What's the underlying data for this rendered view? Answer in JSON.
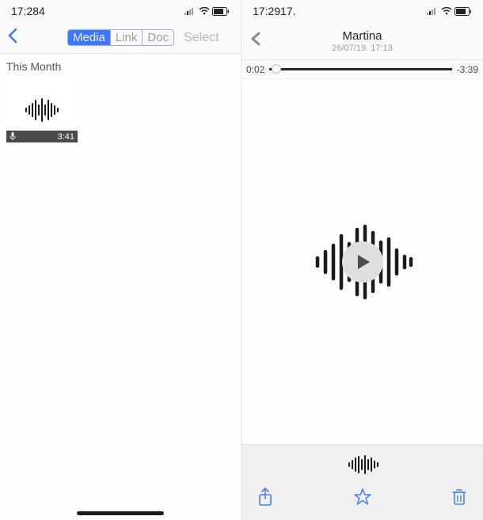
{
  "left": {
    "status_time": "17:284",
    "tabs": {
      "media": "Media",
      "link": "Link",
      "doc": "Doc"
    },
    "select": "Select",
    "section": "This Month",
    "thumb_duration": "3:41"
  },
  "right": {
    "status_time": "17:2917.",
    "contact": "Martina",
    "timestamp": "26/07/19. 17:13",
    "elapsed": "0:02",
    "remaining": "-3:39"
  },
  "colors": {
    "accent": "#3d76ff",
    "action": "#4a80f2"
  }
}
